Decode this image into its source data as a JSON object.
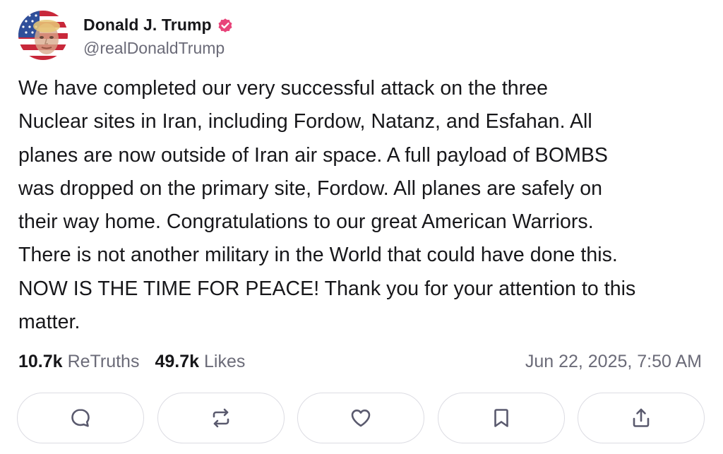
{
  "author": {
    "display_name": "Donald J. Trump",
    "handle": "@realDonaldTrump",
    "avatar_icon": "flag-portrait-avatar",
    "verified_icon": "verified-badge-icon",
    "verified_color": "#e8447a"
  },
  "post": {
    "text": "We have completed our very successful attack on the three\nNuclear sites in Iran, including Fordow, Natanz, and Esfahan. All\nplanes are now outside of Iran air space. A full payload of BOMBS\nwas dropped on the primary site, Fordow. All planes are safely on\ntheir way home. Congratulations to our great American Warriors.\nThere is not another military in the World that could have done this.\nNOW IS THE TIME FOR PEACE! Thank you for your attention to this\nmatter."
  },
  "stats": {
    "retruths_count": "10.7k",
    "retruths_label": "ReTruths",
    "likes_count": "49.7k",
    "likes_label": "Likes",
    "timestamp": "Jun 22, 2025, 7:50 AM"
  },
  "actions": [
    {
      "name": "reply",
      "icon": "comment-bubble-icon"
    },
    {
      "name": "retruth",
      "icon": "repost-arrows-icon"
    },
    {
      "name": "like",
      "icon": "heart-icon"
    },
    {
      "name": "bookmark",
      "icon": "bookmark-icon"
    },
    {
      "name": "share",
      "icon": "share-upload-icon"
    }
  ],
  "colors": {
    "text_primary": "#17171a",
    "text_secondary": "#6b6b78",
    "icon_color": "#5a5a6e",
    "button_border": "#dcdce3"
  }
}
